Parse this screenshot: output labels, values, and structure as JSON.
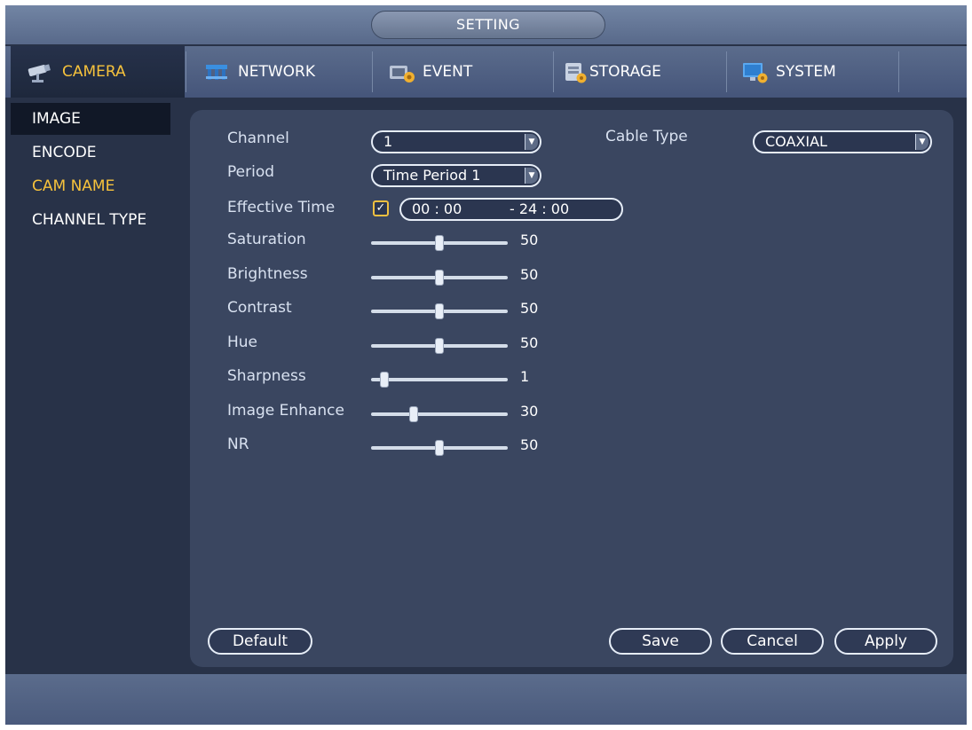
{
  "window": {
    "title": "SETTING"
  },
  "tabs": [
    {
      "label": "CAMERA",
      "icon": "camera-icon",
      "active": true
    },
    {
      "label": "NETWORK",
      "icon": "network-icon",
      "active": false
    },
    {
      "label": "EVENT",
      "icon": "event-icon",
      "active": false
    },
    {
      "label": "STORAGE",
      "icon": "storage-icon",
      "active": false
    },
    {
      "label": "SYSTEM",
      "icon": "system-icon",
      "active": false
    }
  ],
  "sidemenu": [
    {
      "label": "IMAGE",
      "selected": true
    },
    {
      "label": "ENCODE"
    },
    {
      "label": "CAM NAME"
    },
    {
      "label": "CHANNEL TYPE"
    }
  ],
  "form": {
    "channel_label": "Channel",
    "channel_value": "1",
    "cable_type_label": "Cable Type",
    "cable_type_value": "COAXIAL",
    "period_label": "Period",
    "period_value": "Time Period 1",
    "effective_time_label": "Effective Time",
    "effective_time_enabled": true,
    "effective_start": "00 : 00",
    "effective_end": "- 24 : 00"
  },
  "sliders": [
    {
      "label": "Saturation",
      "value": 50,
      "max": 100
    },
    {
      "label": "Brightness",
      "value": 50,
      "max": 100
    },
    {
      "label": "Contrast",
      "value": 50,
      "max": 100
    },
    {
      "label": "Hue",
      "value": 50,
      "max": 100
    },
    {
      "label": "Sharpness",
      "value": 1,
      "max": 15
    },
    {
      "label": "Image Enhance",
      "value": 30,
      "max": 100
    },
    {
      "label": "NR",
      "value": 50,
      "max": 100
    }
  ],
  "buttons": {
    "default": "Default",
    "save": "Save",
    "cancel": "Cancel",
    "apply": "Apply"
  },
  "colors": {
    "accent": "#f6c23c",
    "background": "#283248",
    "panel": "#3a4660"
  }
}
